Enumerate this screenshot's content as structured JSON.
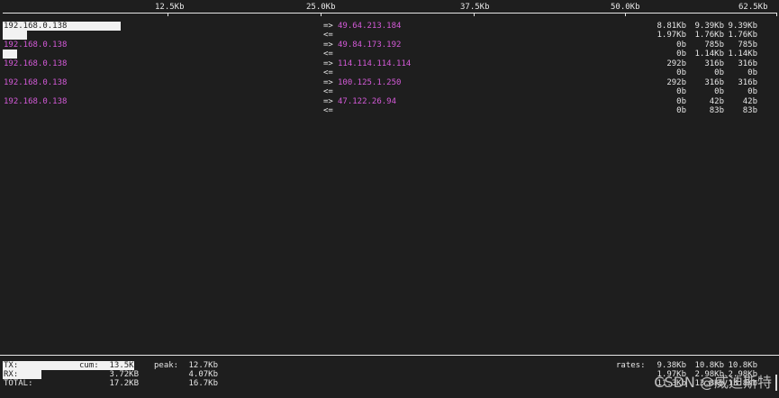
{
  "scale": {
    "labels": [
      "12.5Kb",
      "25.0Kb",
      "37.5Kb",
      "50.0Kb",
      "62.5Kb"
    ]
  },
  "flows": [
    {
      "source": "192.168.0.138",
      "dest": "49.64.213.184",
      "out_dir": "=>",
      "in_dir": "<=",
      "out_rates": [
        "8.81Kb",
        "9.39Kb",
        "9.39Kb"
      ],
      "in_rates": [
        "1.97Kb",
        "1.76Kb",
        "1.76Kb"
      ]
    },
    {
      "source": "192.168.0.138",
      "dest": "49.84.173.192",
      "out_dir": "=>",
      "in_dir": "<=",
      "out_rates": [
        "0b",
        "785b",
        "785b"
      ],
      "in_rates": [
        "0b",
        "1.14Kb",
        "1.14Kb"
      ]
    },
    {
      "source": "192.168.0.138",
      "dest": "114.114.114.114",
      "out_dir": "=>",
      "in_dir": "<=",
      "out_rates": [
        "292b",
        "316b",
        "316b"
      ],
      "in_rates": [
        "0b",
        "0b",
        "0b"
      ]
    },
    {
      "source": "192.168.0.138",
      "dest": "100.125.1.250",
      "out_dir": "=>",
      "in_dir": "<=",
      "out_rates": [
        "292b",
        "316b",
        "316b"
      ],
      "in_rates": [
        "0b",
        "0b",
        "0b"
      ]
    },
    {
      "source": "192.168.0.138",
      "dest": "47.122.26.94",
      "out_dir": "=>",
      "in_dir": "<=",
      "out_rates": [
        "0b",
        "42b",
        "42b"
      ],
      "in_rates": [
        "0b",
        "83b",
        "83b"
      ]
    }
  ],
  "footer": {
    "tx_label": "TX:",
    "rx_label": "RX:",
    "total_label": "TOTAL:",
    "cum_label": "cum:",
    "peak_label": "peak:",
    "rates_label": "rates:",
    "tx_cum": "13.5KB",
    "rx_cum": "3.72KB",
    "total_cum": "17.2KB",
    "tx_peak": "12.7Kb",
    "rx_peak": "4.07Kb",
    "total_peak": "16.7Kb",
    "tx_rates": [
      "9.38Kb",
      "10.8Kb",
      "10.8Kb"
    ],
    "rx_rates": [
      "1.97Kb",
      "2.98Kb",
      "2.98Kb"
    ],
    "total_rates": [
      "11.3Kb",
      "13.8Kb",
      "13.8Kb"
    ]
  },
  "levels": {
    "tx_fill_fraction": 0.17,
    "rx_fill_fraction": 0.05
  },
  "watermark": "CSDN @威迪斯特",
  "colors": {
    "background": "#1e1e1e",
    "foreground": "#e6e6e6",
    "host_accent": "#d45ad8",
    "bar_fill": "#f2f2f2"
  }
}
